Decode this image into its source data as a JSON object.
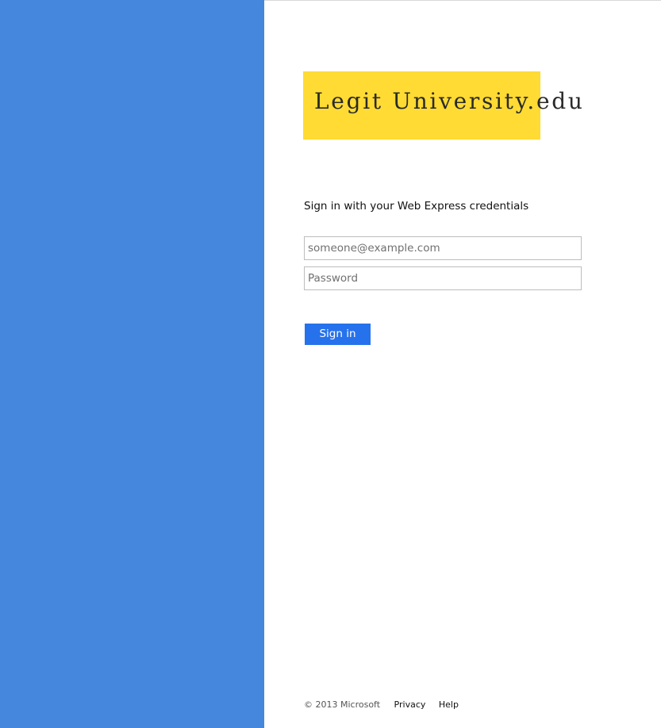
{
  "branding": {
    "logo_text": "Legit University.edu",
    "logo_background": "#ffdb33",
    "side_panel_color": "#4487dc"
  },
  "form": {
    "heading": "Sign in with your Web Express credentials",
    "email_placeholder": "someone@example.com",
    "email_value": "",
    "password_placeholder": "Password",
    "password_value": "",
    "submit_label": "Sign in",
    "submit_color": "#2672ec"
  },
  "footer": {
    "copyright": "© 2013 Microsoft",
    "links": [
      {
        "label": "Privacy"
      },
      {
        "label": "Help"
      }
    ]
  }
}
